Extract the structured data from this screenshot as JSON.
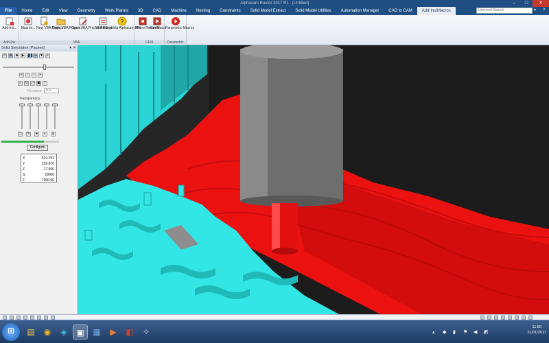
{
  "window": {
    "title": "Alphacam Router 2017 R1 - [Untitled]"
  },
  "menu": {
    "file": "File",
    "items": [
      "Home",
      "Edit",
      "View",
      "Geometry",
      "Work Planes",
      "3D",
      "CAD",
      "Machine",
      "Nesting",
      "Constraints",
      "Solid Model Extract",
      "Solid Model Utilities",
      "Automation Manager",
      "CAD to CAM",
      "Add-Ins/Macros"
    ],
    "search_placeholder": "Licensed Search"
  },
  "ribbon": {
    "groups": [
      {
        "label": "Add-Ins",
        "buttons": [
          "Add-Ins..."
        ]
      },
      {
        "label": "VBA",
        "buttons": [
          "Macros...",
          "New VBA Project",
          "Open VBA Project...",
          "Open VBA Proj for Editing...",
          "VBA Editor",
          "Help Alphacam API"
        ]
      },
      {
        "label": "OEM",
        "buttons": [
          "Macro Recorder",
          "Run Macro"
        ]
      },
      {
        "label": "Parametric",
        "buttons": [
          "Parametric Macros"
        ]
      }
    ]
  },
  "sim_panel": {
    "title": "Solid Simulation (Paused)",
    "transparency_label": "Transparency",
    "tolerance_label": "Tolerance",
    "tolerance_value": "0.0",
    "configure_label": "Configure",
    "progress": 0.74,
    "values": [
      {
        "axis": "X",
        "value": "522.752"
      },
      {
        "axis": "Y",
        "value": "229.870"
      },
      {
        "axis": "Z",
        "value": "-17.660"
      },
      {
        "axis": "S",
        "value": "18000"
      },
      {
        "axis": "F",
        "value": "7000.00"
      }
    ]
  },
  "taskbar": {
    "time": "11:50",
    "date": "31/01/2017"
  },
  "colors": {
    "ribbon_blue": "#1f4e82",
    "material_red": "#ef0f0f",
    "fixture_cyan": "#33e6e6",
    "tool_grey": "#6e6e6e",
    "progress_green": "#2fb34a"
  }
}
